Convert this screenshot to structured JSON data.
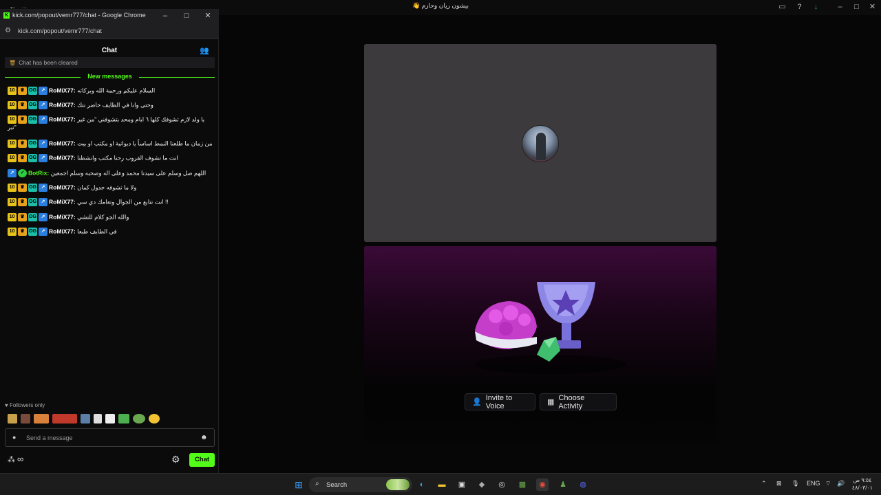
{
  "background_window": {
    "title": "👋 بيشون ريان وحازم",
    "invite_label": "Invite to Voice",
    "activity_label": "Choose Activity"
  },
  "chrome": {
    "title": "kick.com/popout/vemr777/chat - Google Chrome",
    "url": "kick.com/popout/vemr777/chat",
    "favicon": "K"
  },
  "chat": {
    "title": "Chat",
    "cleared_text": "Chat has been cleared",
    "new_messages_label": "New messages",
    "followers_only": "Followers only",
    "input_placeholder": "Send a message",
    "send_label": "Chat",
    "messages": [
      {
        "user": "RoMiX77",
        "text": "السلام عليكم ورحمة الله وبركاته"
      },
      {
        "user": "RoMiX77",
        "text": "وحتى وانا في الطايف حاضر نتك"
      },
      {
        "user": "RoMiX77",
        "text": "يا ولد لازم تشوفك كلها ٦ ايام ومحد بتشوفني \"من غير \"تبر"
      },
      {
        "user": "RoMiX77",
        "text": "من زمان ما طلعنا النمط اساساً يا ديوانية او مكتب او بيت"
      },
      {
        "user": "RoMiX77",
        "text": "انت ما تشوف القروب رحنا مكتب وانشطنا"
      },
      {
        "user": "BotRix",
        "text": "اللهم صل وسلم على سيدنا محمد وعلى اله وصحبه وسلم اجمعين",
        "bot": true
      },
      {
        "user": "RoMiX77",
        "text": "ولا ما تشوفه جدول كمان"
      },
      {
        "user": "RoMiX77",
        "text": "انت تتابع من الجوال وتعامك دي سي !!"
      },
      {
        "user": "RoMiX77",
        "text": "والله الجو كلام للنشي"
      },
      {
        "user": "RoMiX77",
        "text": "في الطايف طبعا"
      }
    ],
    "badge_ten": "10"
  },
  "taskbar": {
    "search_label": "Search",
    "lang": "ENG",
    "time": "٩:٥٤ ص",
    "date": "٤٨/٠٣/٠١"
  }
}
